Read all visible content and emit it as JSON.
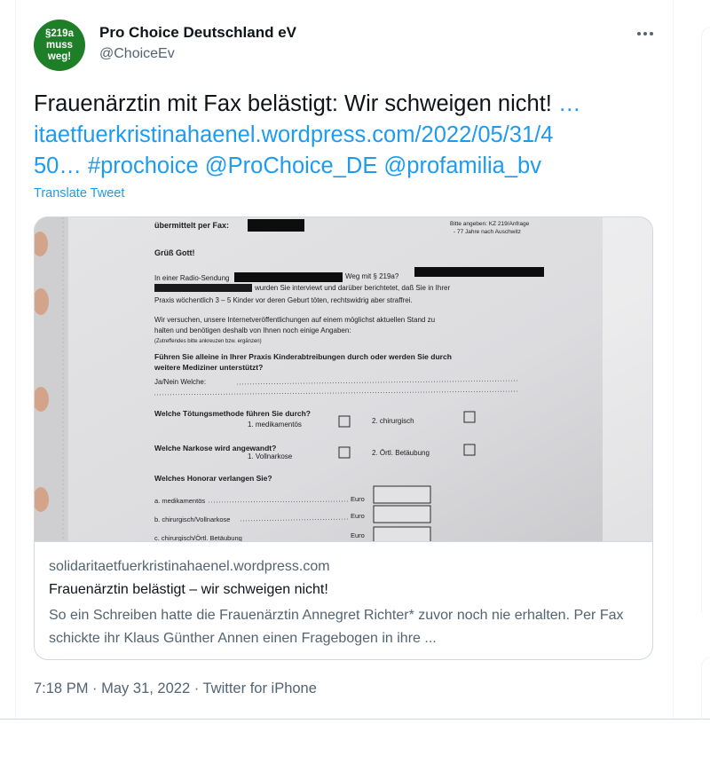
{
  "author": {
    "avatar_lines": [
      "§219a",
      "muss",
      "weg!"
    ],
    "name": "Pro Choice Deutschland eV",
    "handle": "@ChoiceEv"
  },
  "tweet": {
    "line1_text": "Frauenärztin mit Fax belästigt: Wir schweigen nicht! ",
    "line1_link": "…",
    "line2_link": "itaetfuerkristinahaenel.wordpress.com/2022/05/31/4",
    "line3_link": "50… #prochoice @ProChoice_DE @profamilia_bv",
    "translate_label": "Translate Tweet"
  },
  "card": {
    "domain": "solidaritaetfuerkristinahaenel.wordpress.com",
    "title": "Frauenärztin belästigt – wir schweigen nicht!",
    "description": "So ein Schreiben hatte die Frauenärztin Annegret Richter* zuvor noch nie erhalten. Per Fax schickte ihr Klaus Günther Annen einen Fragebogen in ihre ..."
  },
  "fax": {
    "header_label": "übermittelt per Fax:",
    "ref_line1": "Bitte angeben: KZ 219/Anfrage",
    "ref_line2": "- 77 Jahre nach Auschwitz",
    "greeting": "Grüß Gott!",
    "p1_a": "In einer Radio-Sendung",
    "p1_b": "Weg mit § 219a?",
    "p1_c": "wurden Sie interviewt und darüber berichtetet, daß Sie in Ihrer",
    "p1_d": "Praxis wöchentlich 3 – 5 Kinder vor deren Geburt töten, rechtswidrig aber straffrei.",
    "p2_a": "Wir versuchen, unsere Internetveröffentlichungen auf einem möglichst aktuellen Stand zu",
    "p2_b": "halten und benötigen deshalb von Ihnen noch einige Angaben:",
    "p2_c": "(Zutreffendes bitte ankreuzen bzw. ergänzen)",
    "q1_a": "Führen Sie alleine in Ihrer Praxis Kinderabtreibungen durch oder werden Sie durch",
    "q1_b": "weitere Mediziner unterstützt?",
    "q1_c": "Ja/Nein    Welche:",
    "q2": "Welche Tötungsmethode führen Sie durch?",
    "q2_opt1": "1. medikamentös",
    "q2_opt2": "2. chirurgisch",
    "q3": "Welche Narkose wird angewandt?",
    "q3_opt1": "1. Vollnarkose",
    "q3_opt2": "2. Örtl. Betäubung",
    "q4": "Welches Honorar verlangen Sie?",
    "fee_a": "a. medikamentös",
    "fee_b": "b. chirurgisch/Vollnarkose",
    "fee_c": "c. chirurgisch/Örtl. Betäubung",
    "currency": "Euro"
  },
  "meta": {
    "time": "7:18 PM",
    "date": "May 31, 2022",
    "source": "Twitter for iPhone",
    "separator": "·"
  },
  "colors": {
    "accent": "#1d9bf0",
    "avatar_bg": "#1f7f28",
    "muted": "#536471",
    "border": "#cfd9de"
  }
}
